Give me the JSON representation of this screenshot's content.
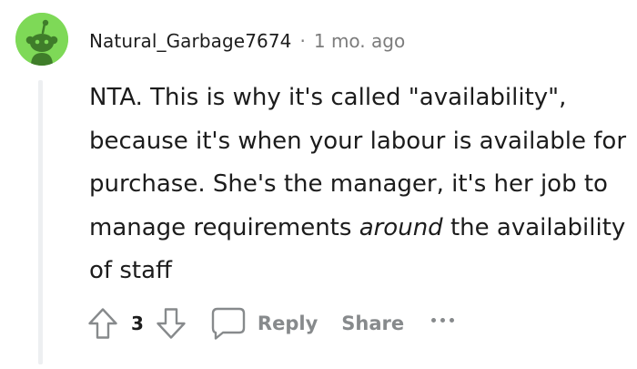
{
  "comment": {
    "author": "Natural_Garbage7674",
    "separator": "·",
    "timestamp": "1 mo. ago",
    "body": {
      "part1": "NTA. This is why it's called \"availability\", because it's when your labour is available for purchase. She's the manager, it's her job to manage requirements ",
      "emphasis": "around",
      "part2": " the availability of staff"
    },
    "votes": "3",
    "actions": {
      "reply": "Reply",
      "share": "Share"
    }
  },
  "colors": {
    "avatar_bg": "#7ed957",
    "text": "#1c1c1c",
    "meta": "#7c7c7c",
    "action": "#878a8c",
    "thread_line": "#edeff1"
  },
  "icons": [
    "snoo-avatar-icon",
    "upvote-arrow-icon",
    "downvote-arrow-icon",
    "comment-bubble-icon",
    "more-options-icon"
  ]
}
